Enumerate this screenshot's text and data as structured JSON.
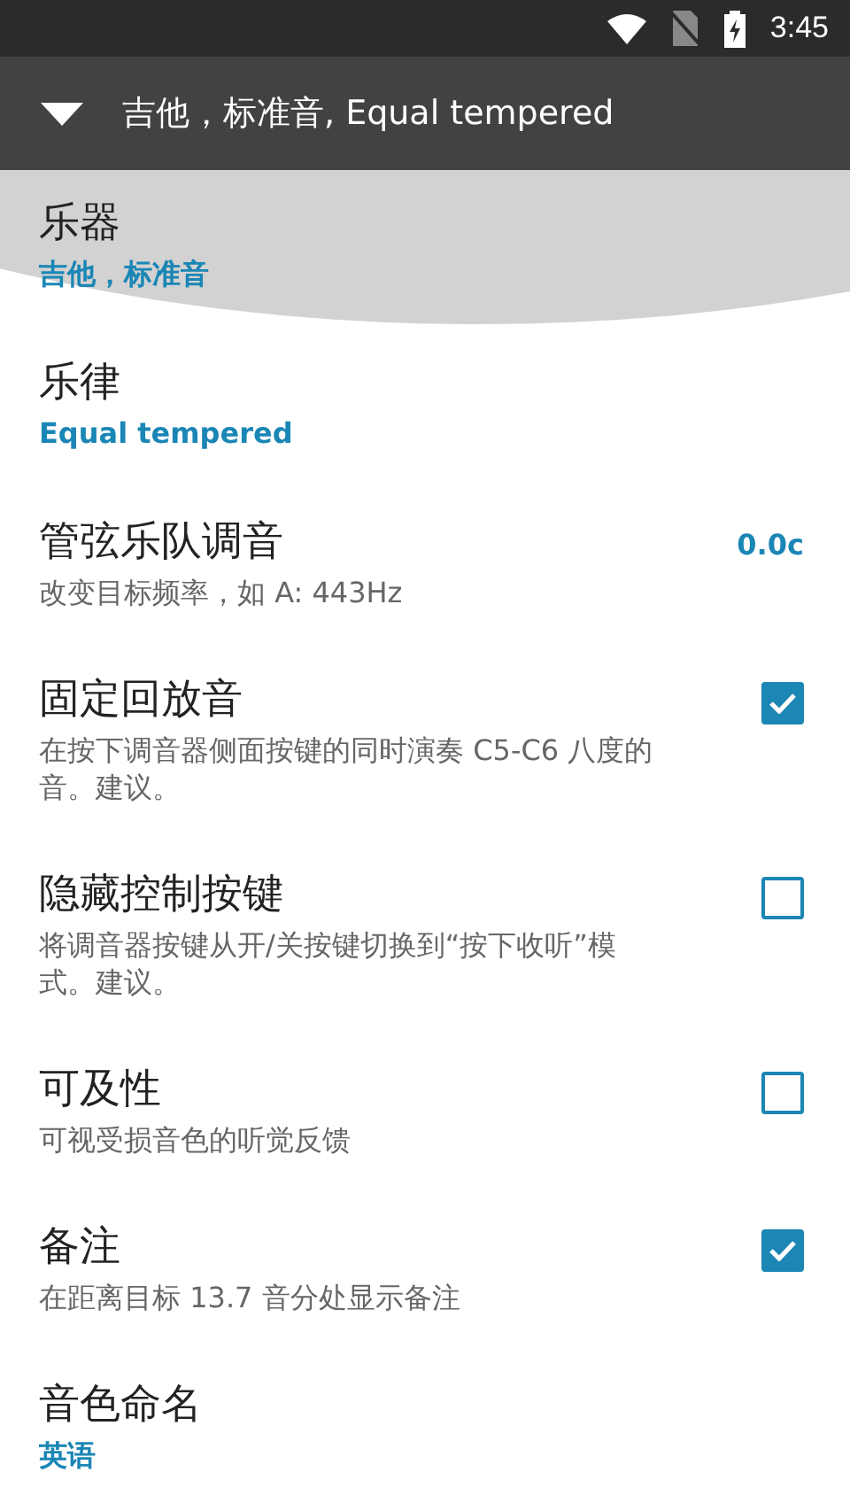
{
  "status_bar": {
    "time": "3:45"
  },
  "toolbar": {
    "title": "吉他，标准音, Equal tempered"
  },
  "items": [
    {
      "kind": "select",
      "title": "乐器",
      "value": "吉他，标准音",
      "pressed": true
    },
    {
      "kind": "select",
      "title": "乐律",
      "value": "Equal tempered",
      "pressed": false
    },
    {
      "kind": "reading",
      "title": "管弦乐队调音",
      "summary": "改变目标频率，如 A: 443Hz",
      "reading": "0.0c",
      "pressed": false
    },
    {
      "kind": "checkbox",
      "title": "固定回放音",
      "summary": "在按下调音器侧面按键的同时演奏 C5-C6 八度的音。建议。",
      "checked": true,
      "pressed": false
    },
    {
      "kind": "checkbox",
      "title": "隐藏控制按键",
      "summary": "将调音器按键从开/关按键切换到“按下收听”模式。建议。",
      "checked": false,
      "pressed": false
    },
    {
      "kind": "checkbox",
      "title": "可及性",
      "summary": "可视受损音色的听觉反馈",
      "checked": false,
      "pressed": false
    },
    {
      "kind": "checkbox",
      "title": "备注",
      "summary": "在距离目标 13.7 音分处显示备注",
      "checked": true,
      "pressed": false
    },
    {
      "kind": "select",
      "title": "音色命名",
      "value": "英语",
      "pressed": false
    }
  ]
}
